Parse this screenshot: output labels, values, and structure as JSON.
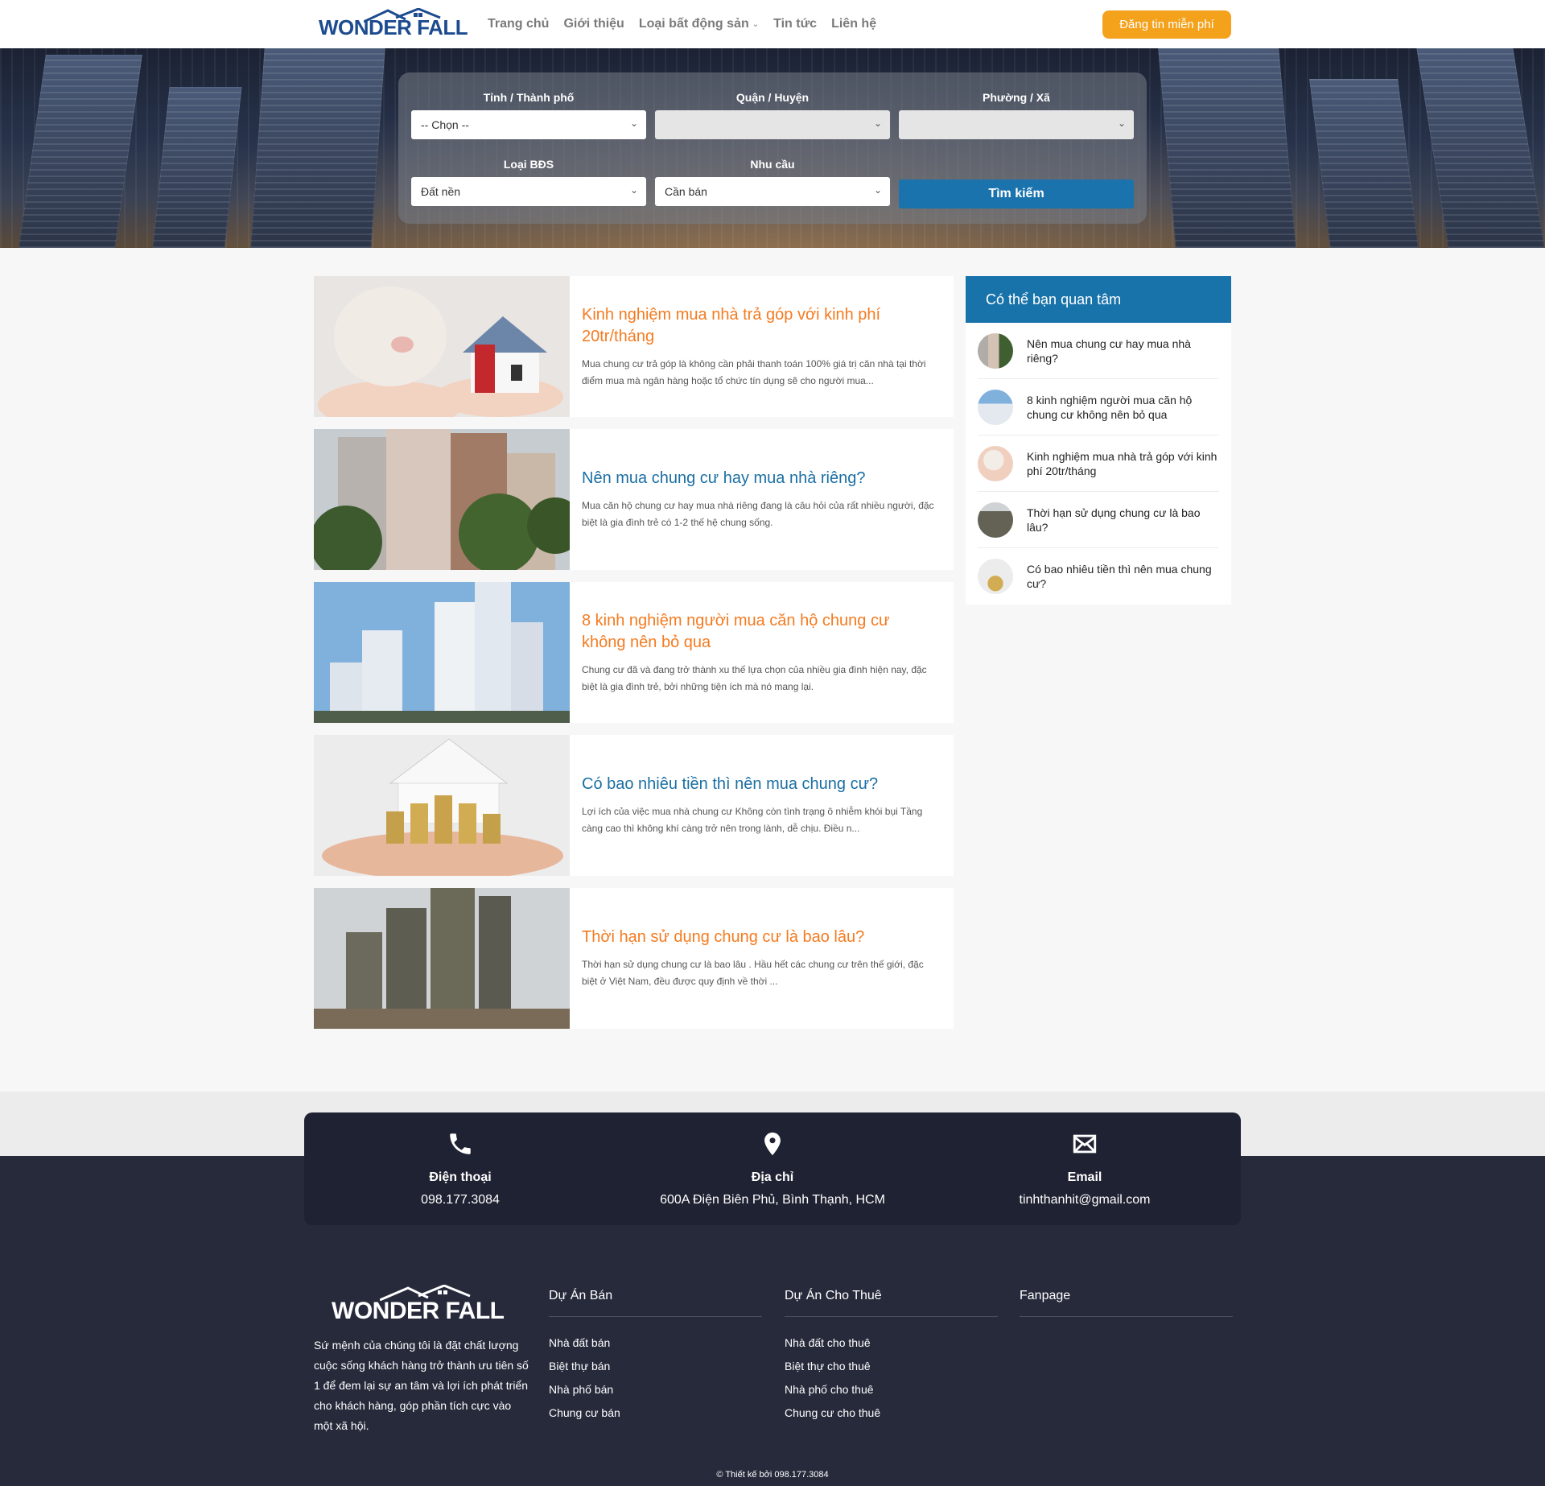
{
  "header": {
    "logo_text": "WONDER FALL",
    "nav": [
      "Trang chủ",
      "Giới thiệu",
      "Loại bất động sản",
      "Tin tức",
      "Liên hệ"
    ],
    "post_button": "Đăng tin miễn phí"
  },
  "search": {
    "province_label": "Tỉnh / Thành phố",
    "province_value": "-- Chọn --",
    "district_label": "Quận / Huyện",
    "district_value": "",
    "ward_label": "Phường / Xã",
    "ward_value": "",
    "type_label": "Loại BĐS",
    "type_value": "Đất nền",
    "need_label": "Nhu cầu",
    "need_value": "Cần bán",
    "button": "Tìm kiếm"
  },
  "posts": [
    {
      "title": "Kinh nghiệm mua nhà trả góp với kinh phí 20tr/tháng",
      "excerpt": "Mua chung cư trả góp là không cần phải thanh toán 100% giá trị căn nhà tại thời điểm mua mà ngân hàng hoặc tổ chức tín dụng sẽ cho người mua..."
    },
    {
      "title": "Nên mua chung cư hay mua nhà riêng?",
      "excerpt": "Mua căn hộ chung cư hay mua nhà riêng đang là câu hỏi của rất nhiều người, đặc biệt là gia đình trẻ có 1-2 thế hệ chung sống."
    },
    {
      "title": "8 kinh nghiệm người mua căn hộ chung cư không nên bỏ qua",
      "excerpt": "Chung cư đã và đang trở thành xu thế lựa chọn của nhiều gia đình hiện nay, đặc biệt là gia đình trẻ, bởi những tiện ích mà nó mang lại."
    },
    {
      "title": "Có bao nhiêu tiền thì nên mua chung cư?",
      "excerpt": "Lợi ích của việc mua nhà chung cư Không còn tình trạng ô nhiễm khói bụi Tầng càng cao thì không khí càng trở nên trong lành, dễ chịu. Điều n..."
    },
    {
      "title": "Thời hạn sử dụng chung cư là bao lâu?",
      "excerpt": "Thời hạn sử dụng chung cư là bao lâu . Hầu hết các chung cư trên thế giới, đặc biệt ở Việt Nam, đều được quy định về thời ..."
    }
  ],
  "sidebar": {
    "title": "Có thể bạn quan tâm",
    "items": [
      "Nên mua chung cư hay mua nhà riêng?",
      "8 kinh nghiệm người mua căn hộ chung cư không nên bỏ qua",
      "Kinh nghiệm mua nhà trả góp với kinh phí 20tr/tháng",
      "Thời hạn sử dụng chung cư là bao lâu?",
      "Có bao nhiêu tiền thì nên mua chung cư?"
    ]
  },
  "contact": {
    "phone_label": "Điện thoại",
    "phone_value": "098.177.3084",
    "address_label": "Địa chỉ",
    "address_value": "600A Điện Biên Phủ, Bình Thạnh, HCM",
    "email_label": "Email",
    "email_value": "tinhthanhit@gmail.com"
  },
  "footer": {
    "logo_text": "WONDER FALL",
    "about": "Sứ mệnh của chúng tôi là đặt chất lượng cuộc sống khách hàng trở thành ưu tiên số 1 để đem lại sự an tâm và lợi ích phát triển cho khách hàng, góp phần tích cực vào một xã hội.",
    "col1_title": "Dự Án Bán",
    "col1_links": [
      "Nhà đất bán",
      "Biệt thự bán",
      "Nhà phố bán",
      "Chung cư bán"
    ],
    "col2_title": "Dự Án Cho Thuê",
    "col2_links": [
      "Nhà đất cho thuê",
      "Biệt thự cho thuê",
      "Nhà phố cho thuê",
      "Chung cư cho thuê"
    ],
    "col3_title": "Fanpage",
    "copyright": "© Thiết kế bởi 098.177.3084"
  },
  "colors": {
    "brand_blue": "#1973ab",
    "accent_orange": "#f4a21c",
    "title_orange": "#f47b20",
    "footer_dark": "#262a3b"
  }
}
